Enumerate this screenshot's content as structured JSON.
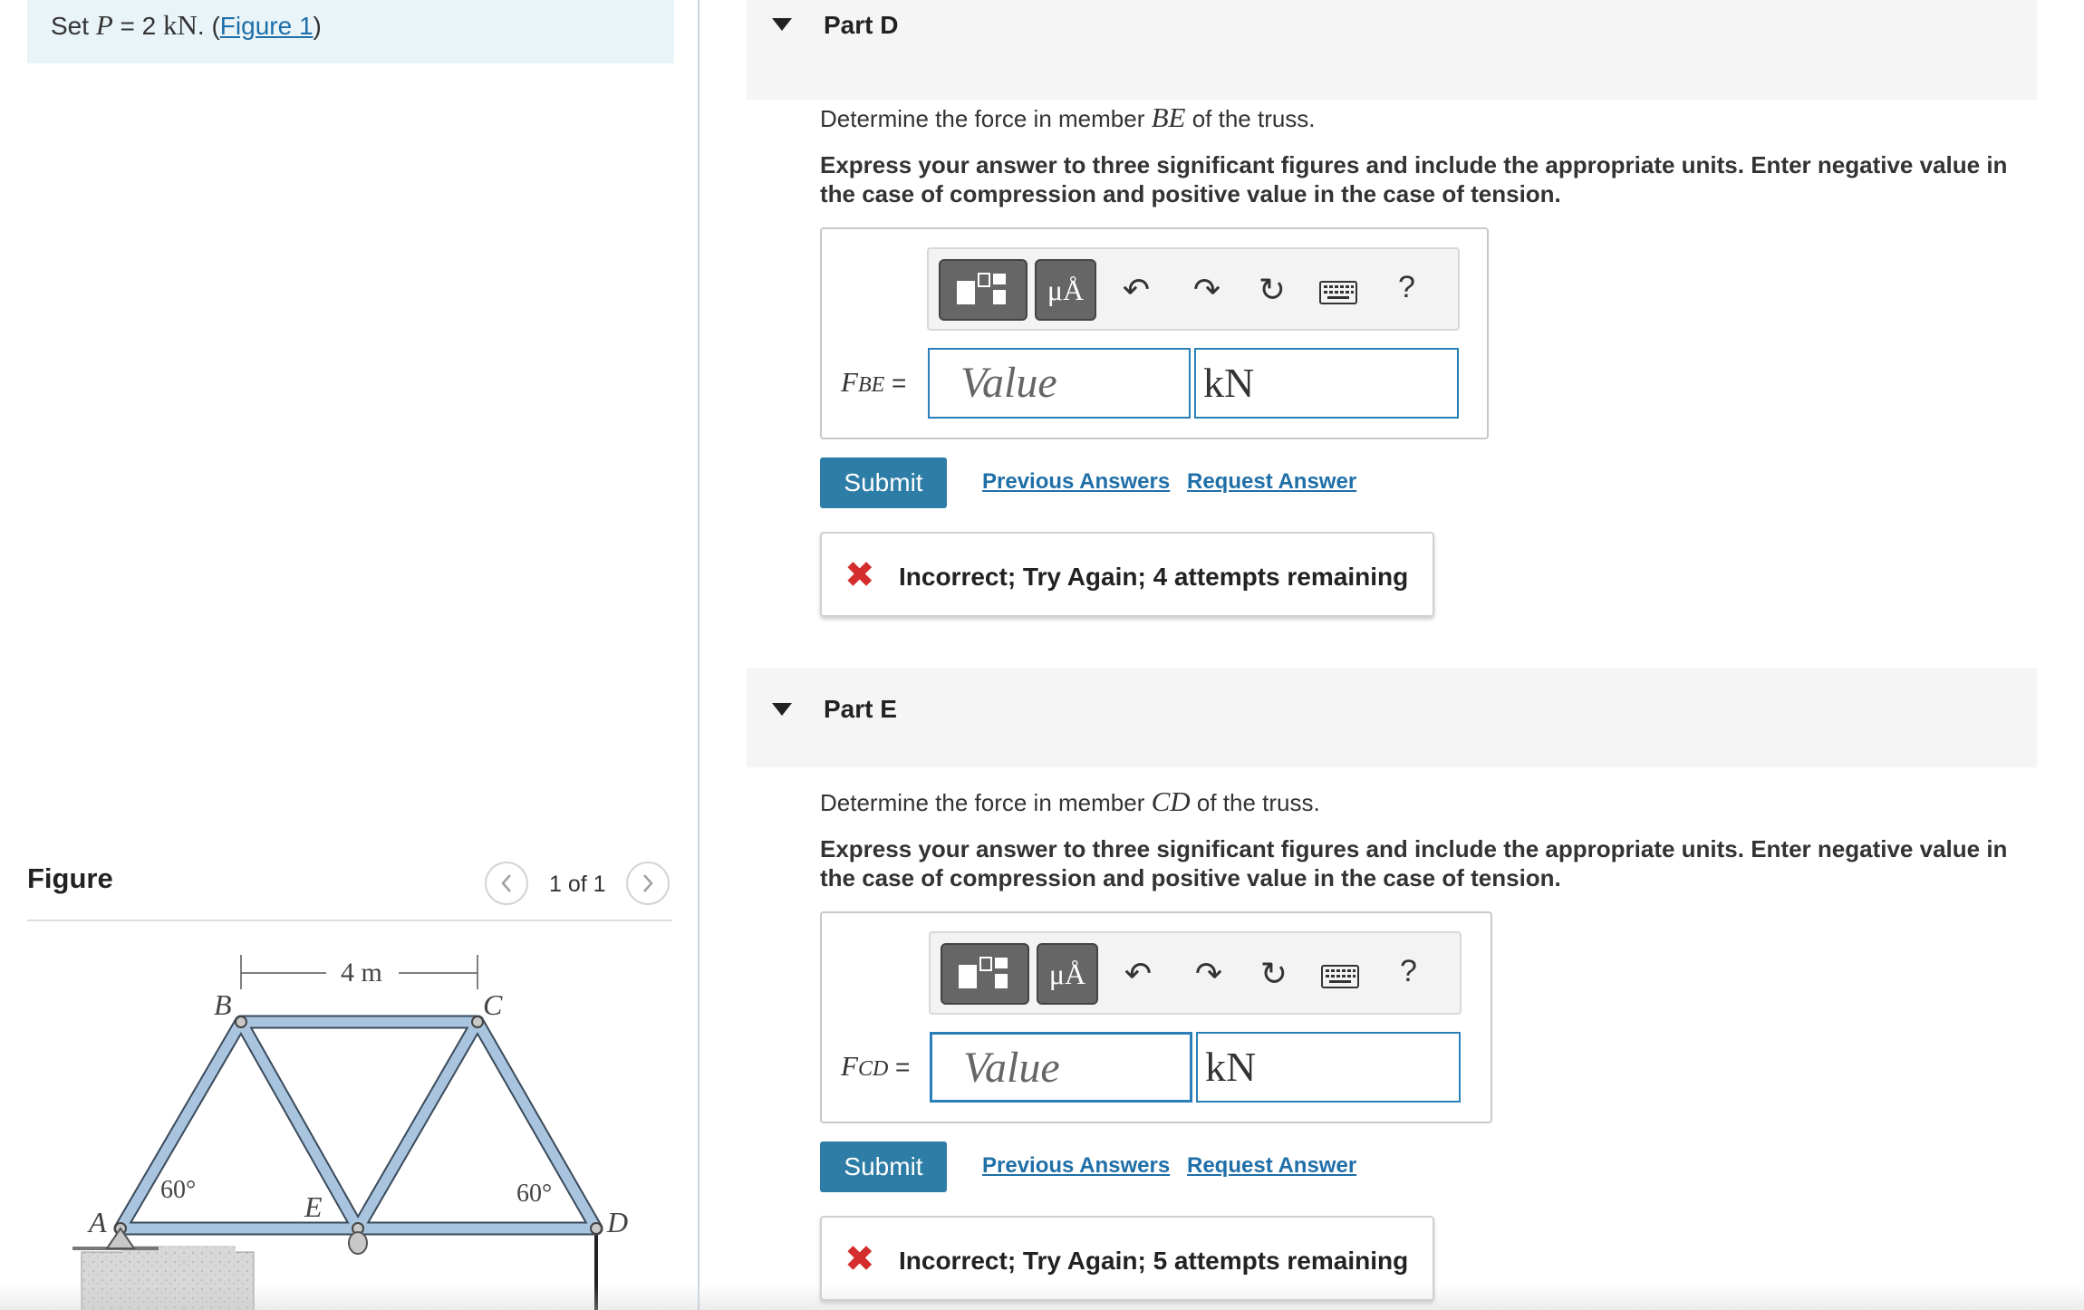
{
  "given": {
    "prefix": "Set ",
    "var": "P",
    "equals": " = 2 ",
    "unit": "kN",
    "period": ". (",
    "link": "Figure 1",
    "close": ")"
  },
  "figure": {
    "title": "Figure",
    "pager": "1 of 1",
    "prev_icon": "chevron-left-icon",
    "next_icon": "chevron-right-icon",
    "labels": {
      "dim": "4 m",
      "A": "A",
      "B": "B",
      "C": "C",
      "D": "D",
      "E": "E",
      "angle_left": "60°",
      "angle_right": "60°"
    }
  },
  "parts": [
    {
      "title": "Part D",
      "question_pre": "Determine the force in member ",
      "member": "BE",
      "question_post": " of the truss.",
      "instructions": "Express your answer to three significant figures and include the appropriate units. Enter negative value in the case of compression and positive value in the case of tension.",
      "var_main": "F",
      "var_sub": "BE",
      "equals": " =",
      "value_placeholder": "Value",
      "unit": "kN",
      "submit": "Submit",
      "prev_answers": "Previous Answers",
      "request_answer": "Request Answer",
      "feedback_icon": "✖",
      "feedback": "Incorrect; Try Again; 4 attempts remaining"
    },
    {
      "title": "Part E",
      "question_pre": "Determine the force in member ",
      "member": "CD",
      "question_post": " of the truss.",
      "instructions": "Express your answer to three significant figures and include the appropriate units. Enter negative value in the case of compression and positive value in the case of tension.",
      "var_main": "F",
      "var_sub": "CD",
      "equals": " =",
      "value_placeholder": "Value",
      "unit": "kN",
      "submit": "Submit",
      "prev_answers": "Previous Answers",
      "request_answer": "Request Answer",
      "feedback_icon": "✖",
      "feedback": "Incorrect; Try Again; 5 attempts remaining"
    }
  ],
  "toolbar": {
    "templates_icon": "templates-icon",
    "units_label": "μÅ",
    "undo_icon": "↶",
    "redo_icon": "↷",
    "reset_icon": "↻",
    "keyboard_icon": "keyboard-icon",
    "help_label": "?"
  },
  "colors": {
    "accent": "#2e7da6",
    "link": "#1f6fa8",
    "error": "#d42d2d",
    "given_bg": "#e8f4f8",
    "truss": "#a9c4de"
  }
}
